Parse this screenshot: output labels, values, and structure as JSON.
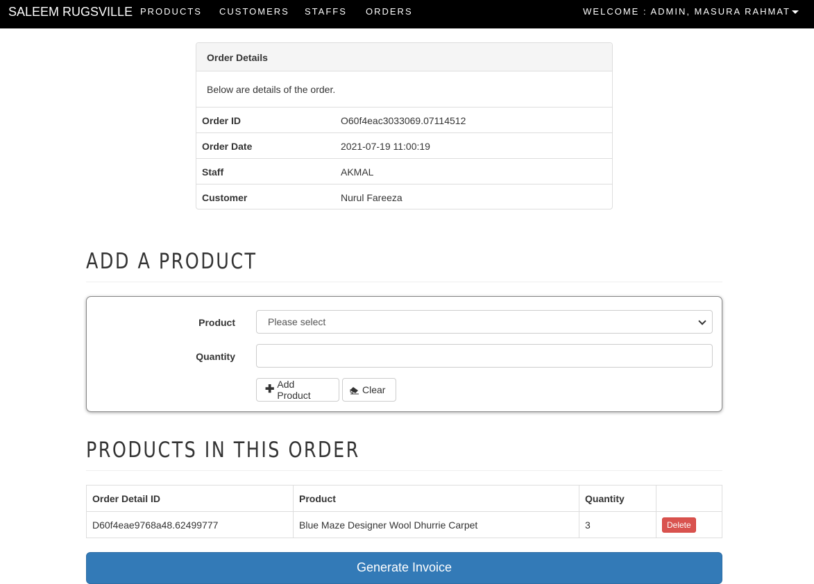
{
  "navbar": {
    "brand": "SALEEM RUGSVILLE",
    "links": [
      "PRODUCTS",
      "CUSTOMERS",
      "STAFFS",
      "ORDERS"
    ],
    "user": "WELCOME : ADMIN, MASURA RAHMAT",
    "background": "#000000"
  },
  "order_details": {
    "heading": "Order Details",
    "description": "Below are details of the order.",
    "rows": [
      {
        "label": "Order ID",
        "value": "O60f4eac3033069.07114512"
      },
      {
        "label": "Order Date",
        "value": "2021-07-19 11:00:19"
      },
      {
        "label": "Staff",
        "value": "AKMAL"
      },
      {
        "label": "Customer",
        "value": "Nurul Fareeza"
      }
    ]
  },
  "add_product": {
    "title": "ADD A PRODUCT",
    "product_label": "Product",
    "product_selected": "Please select",
    "quantity_label": "Quantity",
    "quantity_value": "",
    "add_button": "Add Product",
    "clear_button": "Clear"
  },
  "products_in_order": {
    "title": "PRODUCTS IN THIS ORDER",
    "columns": [
      "Order Detail ID",
      "Product",
      "Quantity",
      ""
    ],
    "rows": [
      {
        "id": "D60f4eae9768a48.62499777",
        "product": "Blue Maze Designer Wool Dhurrie Carpet",
        "quantity": "3",
        "action": "Delete"
      }
    ]
  },
  "generate_invoice": "Generate Invoice",
  "colors": {
    "primary": "#337ab7",
    "danger": "#d9534f"
  }
}
